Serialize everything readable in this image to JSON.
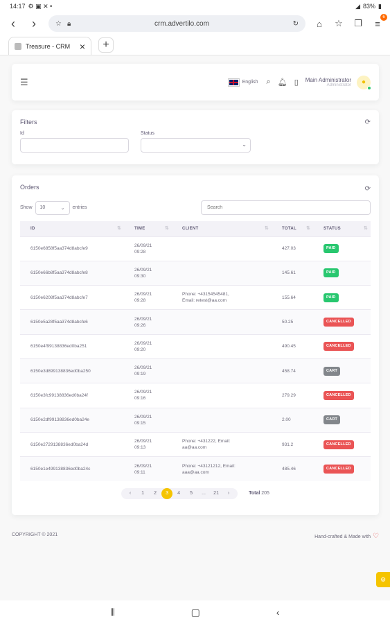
{
  "status_bar": {
    "time": "14:17",
    "battery": "83%"
  },
  "browser": {
    "url": "crm.advertilo.com",
    "tab_title": "Treasure - CRM",
    "badge_count": "6"
  },
  "topnav": {
    "language": "English",
    "user_name": "Main Administrator",
    "user_role": "Administrator"
  },
  "filters": {
    "title": "Filters",
    "id_label": "Id",
    "status_label": "Status"
  },
  "orders": {
    "title": "Orders",
    "show_label": "Show",
    "page_size": "10",
    "entries_label": "entries",
    "search_placeholder": "Search",
    "columns": [
      "ID",
      "TIME",
      "CLIENT",
      "TOTAL",
      "STATUS"
    ],
    "rows": [
      {
        "id": "6150e6858f5aa374d8abcfe9",
        "time": "26/09/21\n09:28",
        "client": "",
        "total": "427.03",
        "status": "PAID"
      },
      {
        "id": "6150e66b8f5aa374d8abcfe8",
        "time": "26/09/21\n09:30",
        "client": "",
        "total": "145.61",
        "status": "PAID"
      },
      {
        "id": "6150e6208f5aa374d8abcfe7",
        "time": "26/09/21\n09:28",
        "client": "Phone: +43154545481,\nEmail: retest@aa.com",
        "total": "155.64",
        "status": "PAID"
      },
      {
        "id": "6150e5a28f5aa374d8abcfe6",
        "time": "26/09/21\n09:26",
        "client": "",
        "total": "50.25",
        "status": "CANCELLED"
      },
      {
        "id": "6150e4f99138836ed0ba251",
        "time": "26/09/21\n09:20",
        "client": "",
        "total": "490.45",
        "status": "CANCELLED"
      },
      {
        "id": "6150e3d899138836ed0ba250",
        "time": "26/09/21\n09:19",
        "client": "",
        "total": "458.74",
        "status": "CART"
      },
      {
        "id": "6150e3fc99138836ed0ba24f",
        "time": "26/09/21\n09:16",
        "client": "",
        "total": "279.29",
        "status": "CANCELLED"
      },
      {
        "id": "6150e2df99138836ed0ba24e",
        "time": "26/09/21\n09:15",
        "client": "",
        "total": "2.00",
        "status": "CART"
      },
      {
        "id": "6150e2729138836ed0ba24d",
        "time": "26/09/21\n09:13",
        "client": "Phone: +431222, Email:\naa@aa.com",
        "total": "931.2",
        "status": "CANCELLED"
      },
      {
        "id": "6150e1e499138836ed0ba24c",
        "time": "26/09/21\n09:11",
        "client": "Phone: +43121212, Email:\naaa@aa.com",
        "total": "485.46",
        "status": "CANCELLED"
      }
    ],
    "pagination": [
      "‹",
      "1",
      "2",
      "3",
      "4",
      "5",
      "...",
      "21",
      "›"
    ],
    "active_page": "3",
    "total_label": "Total",
    "total_value": "205"
  },
  "footer": {
    "copyright": "COPYRIGHT © 2021",
    "made_with": "Hand-crafted & Made with"
  },
  "colors": {
    "PAID": "#28c76f",
    "CANCELLED": "#ea5455",
    "CART": "#82868b",
    "accent": "#f5c400"
  }
}
